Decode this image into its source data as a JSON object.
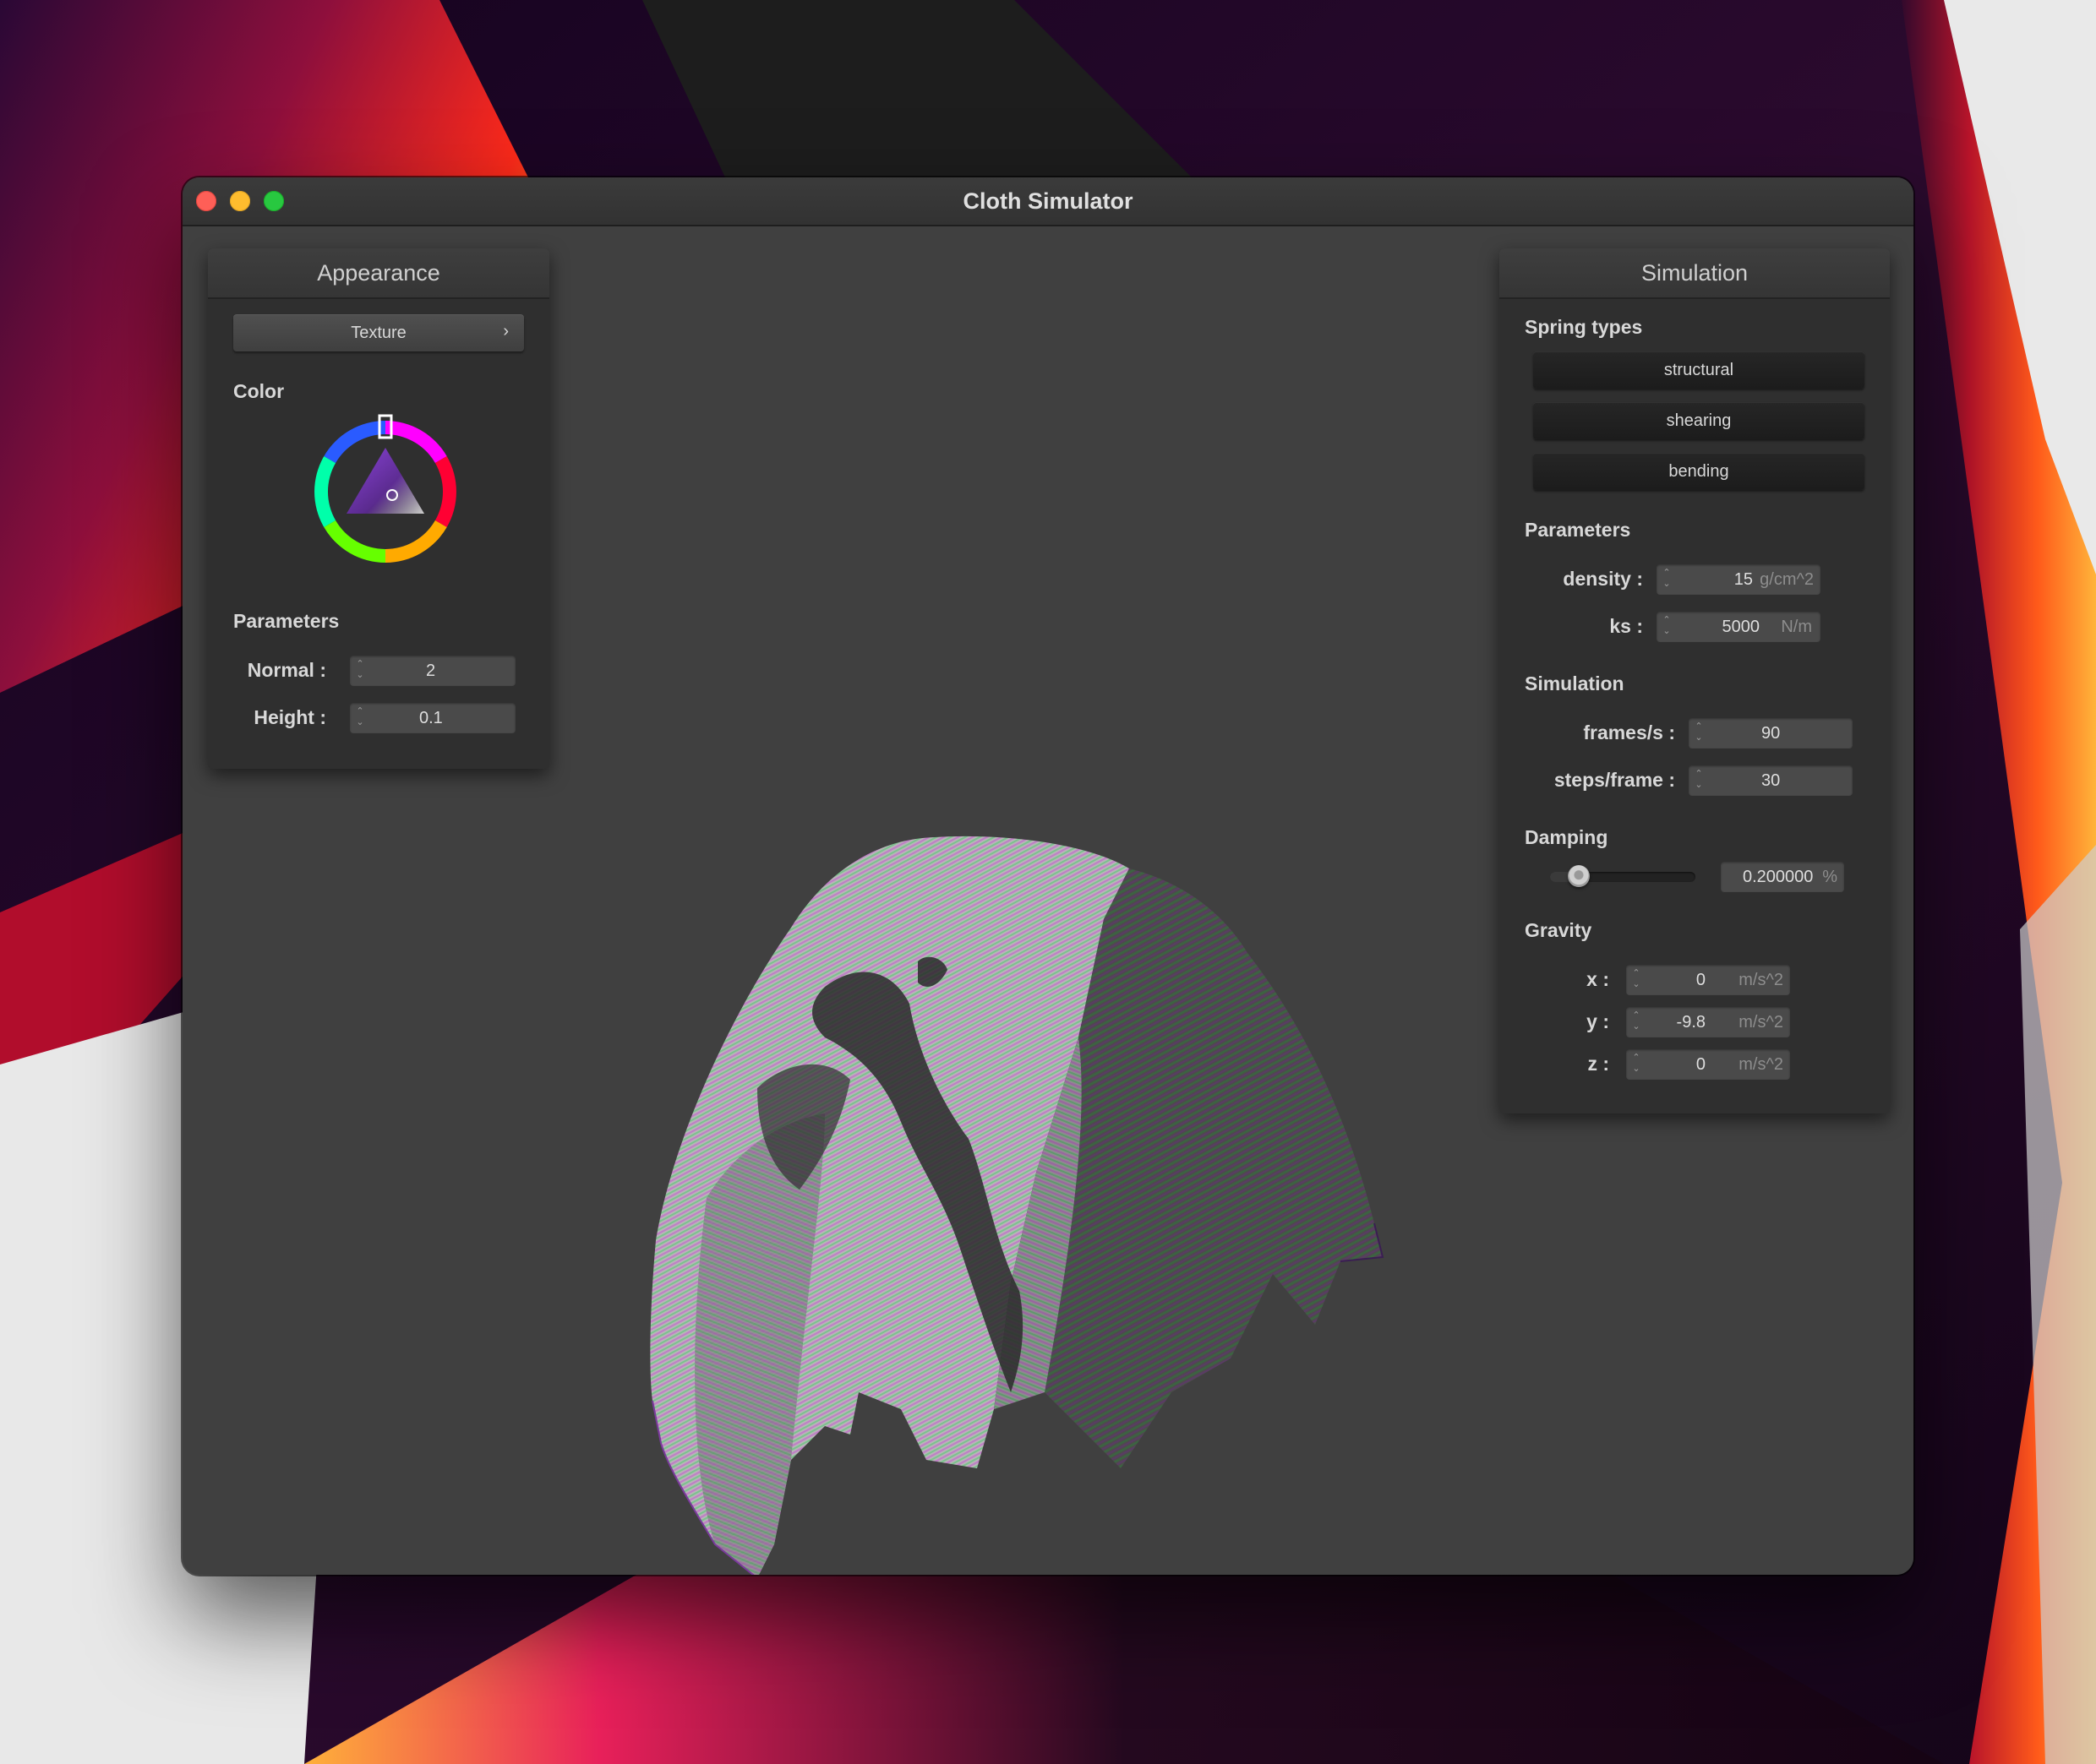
{
  "window": {
    "title": "Cloth Simulator"
  },
  "appearance": {
    "header": "Appearance",
    "texture_button": {
      "label": "Texture",
      "chevron": "›"
    },
    "color_label": "Color",
    "parameters_label": "Parameters",
    "normal": {
      "label": "Normal :",
      "value": "2"
    },
    "height": {
      "label": "Height :",
      "value": "0.1"
    }
  },
  "simulation_panel": {
    "header": "Simulation",
    "spring_types_label": "Spring types",
    "spring_types": [
      "structural",
      "shearing",
      "bending"
    ],
    "parameters_label": "Parameters",
    "density": {
      "label": "density :",
      "value": "15",
      "unit": "g/cm^2"
    },
    "ks": {
      "label": "ks :",
      "value": "5000",
      "unit": "N/m"
    },
    "simulation_label": "Simulation",
    "frames_per_s": {
      "label": "frames/s :",
      "value": "90"
    },
    "steps_per_frame": {
      "label": "steps/frame :",
      "value": "30"
    },
    "damping_label": "Damping",
    "damping": {
      "value": "0.200000",
      "unit": "%",
      "slider_fraction": 0.2
    },
    "gravity_label": "Gravity",
    "gravity": {
      "x": {
        "label": "x :",
        "value": "0",
        "unit": "m/s^2"
      },
      "y": {
        "label": "y :",
        "value": "-9.8",
        "unit": "m/s^2"
      },
      "z": {
        "label": "z :",
        "value": "0",
        "unit": "m/s^2"
      }
    }
  },
  "icons": {
    "close": "red-circle",
    "minimize": "yellow-circle",
    "maximize": "green-circle",
    "spinner": "up-down-arrows",
    "chevron": "chevron-right-icon"
  },
  "colors": {
    "close": "#fe5f57",
    "minimize": "#febc2e",
    "maximize": "#28c840",
    "selected_color": "#8a44d8",
    "viewport_bg": "#404040",
    "panel_bg": "#2f2f2f"
  }
}
